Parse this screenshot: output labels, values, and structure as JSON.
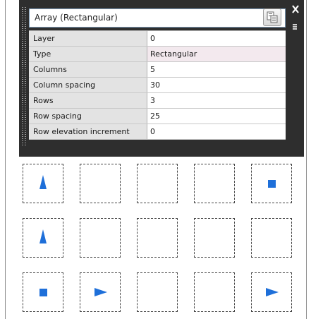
{
  "palette": {
    "selector_text": "Array (Rectangular)",
    "dropdown_icon": "chevron-down-icon",
    "properties_icon": "quick-select-icon",
    "close_icon": "close-icon",
    "menu_icon": "palette-options-icon",
    "accent": "#1e6fd9"
  },
  "properties": [
    {
      "label": "Layer",
      "value": "0"
    },
    {
      "label": "Type",
      "value": "Rectangular"
    },
    {
      "label": "Columns",
      "value": "5"
    },
    {
      "label": "Column spacing",
      "value": "30"
    },
    {
      "label": "Rows",
      "value": "3"
    },
    {
      "label": "Row spacing",
      "value": "25"
    },
    {
      "label": "Row elevation increment",
      "value": "0"
    }
  ],
  "array_grid": {
    "rows": 3,
    "columns": 5,
    "cells": [
      [
        "triangle-up",
        "empty",
        "empty",
        "empty",
        "square"
      ],
      [
        "triangle-up",
        "empty",
        "empty",
        "empty",
        "empty"
      ],
      [
        "square",
        "triangle-right",
        "empty",
        "empty",
        "triangle-right"
      ]
    ]
  }
}
